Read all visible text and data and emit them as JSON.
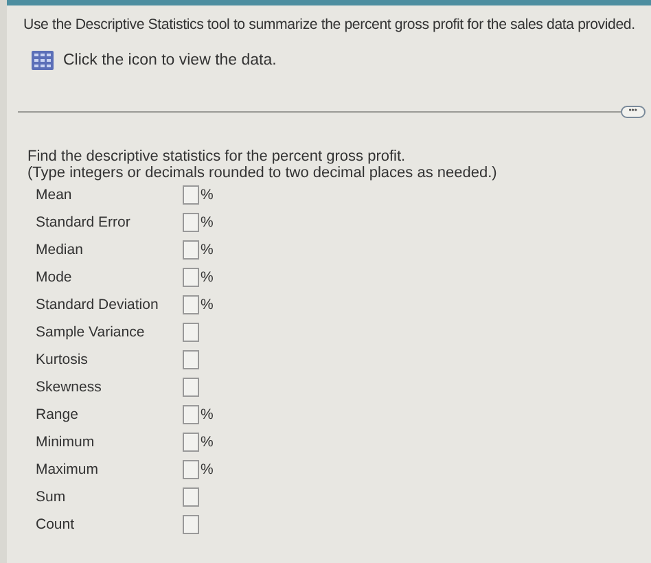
{
  "instruction": "Use the Descriptive Statistics tool to summarize the percent gross profit for the sales data provided.",
  "data_link": "Click the icon to view the data.",
  "more_button": "•••",
  "prompt": "Find the descriptive statistics for the percent gross profit.",
  "hint": "(Type integers or decimals rounded to two decimal places as needed.)",
  "rows": [
    {
      "label": "Mean",
      "unit": "%"
    },
    {
      "label": "Standard Error",
      "unit": "%"
    },
    {
      "label": "Median",
      "unit": "%"
    },
    {
      "label": "Mode",
      "unit": "%"
    },
    {
      "label": "Standard Deviation",
      "unit": "%"
    },
    {
      "label": "Sample Variance"
    },
    {
      "label": "Kurtosis"
    },
    {
      "label": "Skewness"
    },
    {
      "label": "Range",
      "unit": "%"
    },
    {
      "label": "Minimum",
      "unit": "%"
    },
    {
      "label": "Maximum",
      "unit": "%"
    },
    {
      "label": "Sum"
    },
    {
      "label": "Count"
    }
  ]
}
